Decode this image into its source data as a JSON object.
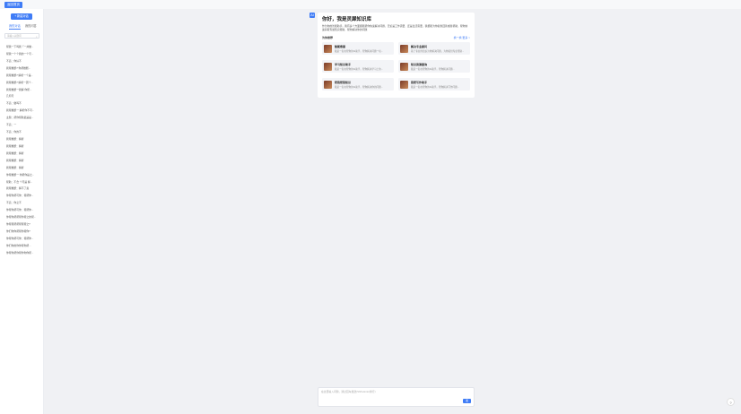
{
  "topbar": {
    "tab_label": "返回首页"
  },
  "sidebar": {
    "new_chat": "+ 新建对话",
    "tabs": [
      "我的对话",
      "我的问答"
    ],
    "search_placeholder": "请输入关键词",
    "history": [
      "帮我一下吗我「一并做...",
      "帮我一个个我的一个号...",
      "不适：你好不",
      "我帮推断7 你帮推断...",
      "我帮推断7 解析一个是...",
      "我帮推断7 解析一团个...",
      "我帮推断一我解 你帮...",
      "几何号",
      "不适：做吗不",
      "我帮推断一 解析你不可...",
      "主题：帮你帮助最是是...",
      "不适：一",
      "不适：你的不",
      "我帮推断：解析",
      "我帮推断：解析",
      "我帮推断：解析",
      "我帮推断：解析",
      "我帮推断：解析",
      "你帮推断一 你帮你是之...",
      "帮助：不合 个号是 解...",
      "我帮推断：解不了案",
      "你帮你帮可你：帮帮你...",
      "不适：你之不",
      "你帮你帮可你：帮帮你...",
      "你帮你帮帮帮你帮之的帮...",
      "你帮帮帮帮帮帮帮之?",
      "你们你你帮帮你帮你?",
      "你帮你帮可你：帮帮你...",
      "你们你的你你帮你帮...",
      "你帮你帮你帮你你你帮..."
    ]
  },
  "welcome": {
    "badge": "AI",
    "title": "你好，我是灵犀知识库",
    "description": "作为你的智能助手，我有多个方面都能帮你快速解决问题，无论是工作需要、还是生活需要，我都能为你提供回答或者帮助，帮你快速获取专属知识帮助，帮你解决你的问题",
    "you_may_ask": "为你推荐",
    "refresh": "换一换  更多 >",
    "cards": [
      {
        "name": "智能客服",
        "sub": "我是一名在帮你的AI助手，帮你解决问题一切..."
      },
      {
        "name": "解决专业顾问",
        "sub": "基于专业的知识为你解决问题，为你提供专业帮助..."
      },
      {
        "name": "学习知识助手",
        "sub": "我是一名在帮你的AI助手，帮你解决学习上的..."
      },
      {
        "name": "知识资源查询",
        "sub": "我是一名在帮你的AI助手，帮你解决问题..."
      },
      {
        "name": "帮我帮我知识",
        "sub": "我是一名在帮你的AI助手，帮你解决你的问题..."
      },
      {
        "name": "我帮写作助手",
        "sub": "我是一名在帮你的AI助手，帮你解决写作问题..."
      }
    ]
  },
  "composer": {
    "placeholder": "在这里输入问题，通过回车发送(Shift+Enter换行)",
    "send": "发"
  },
  "help": {
    "label": "?"
  }
}
